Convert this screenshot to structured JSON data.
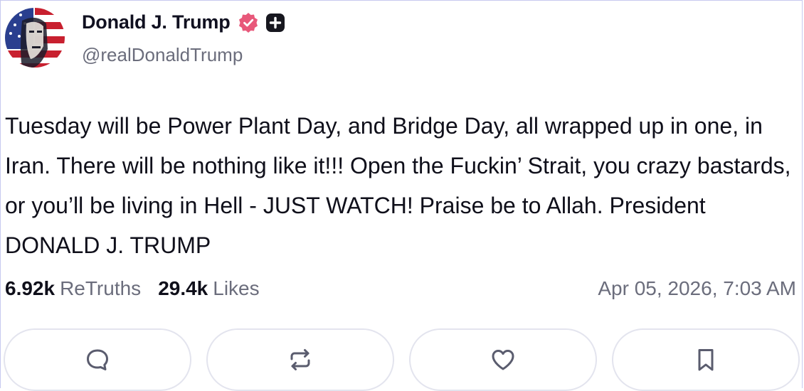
{
  "author": {
    "name": "Donald J. Trump",
    "handle": "@realDonaldTrump",
    "avatar_icon": "avatar-flag-portrait",
    "verified_color": "#e8587a"
  },
  "post": {
    "text": "Tuesday will be Power Plant Day, and Bridge Day, all wrapped up in one, in Iran. There will be nothing like it!!! Open the Fuckin’ Strait, you crazy bastards, or you’ll be living in Hell - JUST WATCH! Praise be to Allah. President DONALD J. TRUMP"
  },
  "stats": {
    "retruths_count": "6.92k",
    "retruths_label": "ReTruths",
    "likes_count": "29.4k",
    "likes_label": "Likes",
    "timestamp": "Apr 05, 2026, 7:03 AM"
  },
  "actions": [
    {
      "icon": "reply-icon"
    },
    {
      "icon": "retruth-icon"
    },
    {
      "icon": "like-icon"
    },
    {
      "icon": "bookmark-icon"
    }
  ],
  "colors": {
    "text": "#0f0f1a",
    "muted": "#6b6d7c",
    "icon": "#5a5c6e",
    "border": "#e3e4ee"
  }
}
